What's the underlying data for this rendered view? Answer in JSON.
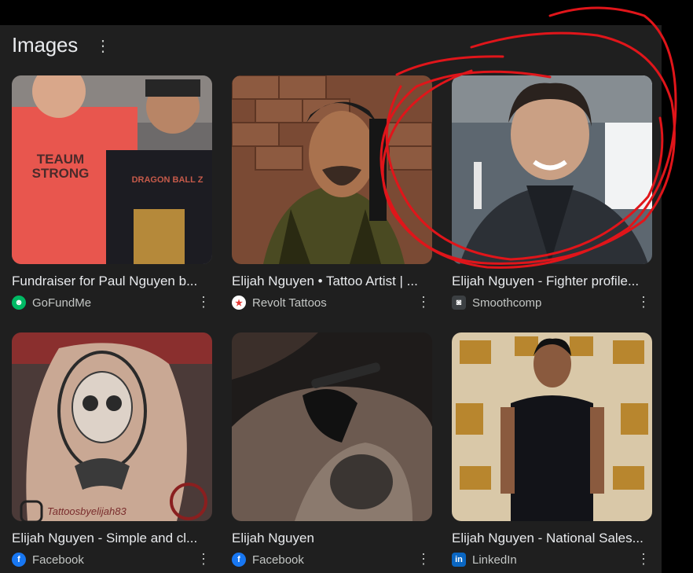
{
  "section": {
    "title": "Images",
    "menu_icon": "more-vert-icon"
  },
  "results": [
    {
      "caption": "Fundraiser for Paul Nguyen b...",
      "source": "GoFundMe",
      "source_icon": "gofundme-icon",
      "source_color": "#00b964"
    },
    {
      "caption": "Elijah Nguyen • Tattoo Artist | ...",
      "source": "Revolt Tattoos",
      "source_icon": "revolt-tattoos-icon",
      "source_color": "#e53935"
    },
    {
      "caption": "Elijah Nguyen - Fighter profile...",
      "source": "Smoothcomp",
      "source_icon": "smoothcomp-icon",
      "source_color": "#3c4043"
    },
    {
      "caption": "Elijah Nguyen - Simple and cl...",
      "source": "Facebook",
      "source_icon": "facebook-icon",
      "source_color": "#1877f2"
    },
    {
      "caption": "Elijah Nguyen",
      "source": "Facebook",
      "source_icon": "facebook-icon",
      "source_color": "#1877f2"
    },
    {
      "caption": "Elijah Nguyen - National Sales...",
      "source": "LinkedIn",
      "source_icon": "linkedin-icon",
      "source_color": "#0a66c2"
    }
  ],
  "image_text": {
    "shirt_line1": "TEAUM",
    "shirt_line2": "STRONG",
    "shirt2": "DRAGON BALL Z",
    "watermark": "Tattoosbyelijah83"
  },
  "annotation": {
    "color": "#e0151a",
    "description": "red hand-drawn circle around third result"
  }
}
